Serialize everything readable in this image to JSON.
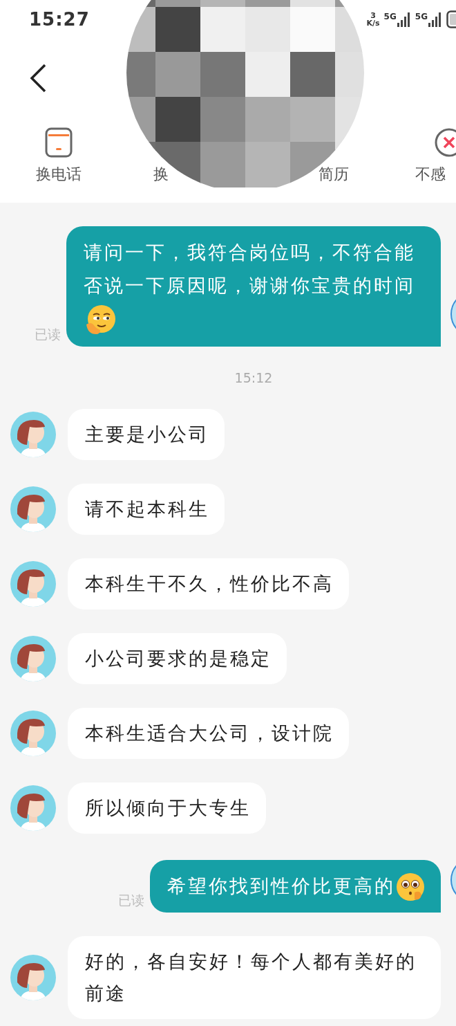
{
  "status_bar": {
    "time": "15:27",
    "speed_value": "3",
    "speed_unit": "K/s",
    "networks": [
      {
        "label": "5G"
      },
      {
        "label": "5G"
      }
    ]
  },
  "actions": [
    {
      "label": "换电话",
      "kind": "phone"
    },
    {
      "label": "换",
      "kind": "hidden"
    },
    {
      "label": "简历",
      "kind": "hidden"
    },
    {
      "label": "不感",
      "kind": "decline"
    }
  ],
  "messages": [
    {
      "kind": "out",
      "text": "请问一下，我符合岗位吗，不符合能否说一下原因呢，谢谢你宝贵的时间",
      "receipt": "已读"
    },
    {
      "kind": "time",
      "text": "15:12"
    },
    {
      "kind": "in",
      "text": "主要是小公司"
    },
    {
      "kind": "in",
      "text": "请不起本科生"
    },
    {
      "kind": "in",
      "text": "本科生干不久，性价比不高"
    },
    {
      "kind": "in",
      "text": "小公司要求的是稳定"
    },
    {
      "kind": "in",
      "text": "本科生适合大公司，设计院"
    },
    {
      "kind": "in",
      "text": "所以倾向于大专生"
    },
    {
      "kind": "out",
      "text": "希望你找到性价比更高的",
      "receipt": "已读"
    },
    {
      "kind": "in",
      "text": "好的，各自安好！每个人都有美好的前途"
    }
  ]
}
